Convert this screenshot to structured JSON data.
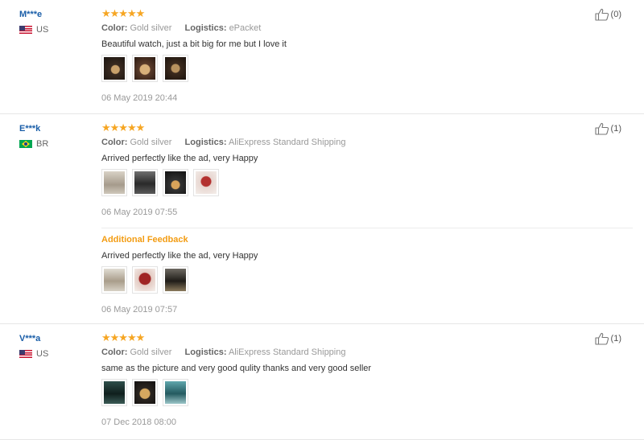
{
  "labels": {
    "color": "Color:",
    "logistics": "Logistics:",
    "additional_feedback": "Additional Feedback"
  },
  "reviews": [
    {
      "user": "M***e",
      "country": "US",
      "stars": "★★★★★",
      "color": "Gold silver",
      "logistics": "ePacket",
      "text": "Beautiful watch, just a bit big for me but I love it",
      "thumb_count": 3,
      "date": "06 May 2019 20:44",
      "likes": "(0)"
    },
    {
      "user": "E***k",
      "country": "BR",
      "stars": "★★★★★",
      "color": "Gold silver",
      "logistics": "AliExpress Standard Shipping",
      "text": "Arrived perfectly like the ad, very Happy",
      "thumb_count": 4,
      "date": "06 May 2019 07:55",
      "likes": "(1)",
      "additional": {
        "text": "Arrived perfectly like the ad, very Happy",
        "thumb_count": 3,
        "date": "06 May 2019 07:57"
      }
    },
    {
      "user": "V***a",
      "country": "US",
      "stars": "★★★★★",
      "color": "Gold silver",
      "logistics": "AliExpress Standard Shipping",
      "text": "same as the picture and very good qulity thanks and very good seller",
      "thumb_count": 3,
      "date": "07 Dec 2018 08:00",
      "likes": "(1)"
    }
  ],
  "icons": {
    "thumbs_up": "thumbs-up-icon",
    "flag_us": "us-flag-icon",
    "flag_br": "br-flag-icon"
  },
  "colors": {
    "username": "#1a5ea8",
    "stars": "#f6a623",
    "additional_feedback": "#f39c12",
    "muted": "#999999"
  }
}
